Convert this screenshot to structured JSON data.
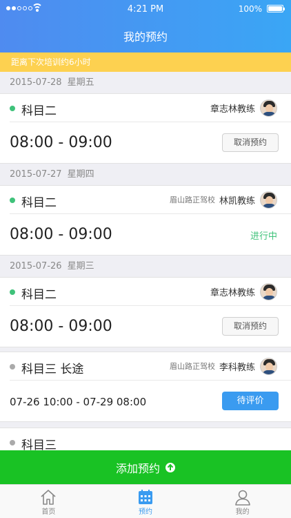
{
  "status_bar": {
    "time": "4:21 PM",
    "battery": "100%"
  },
  "header": {
    "title": "我的预约"
  },
  "banner": {
    "text": "距离下次培训约6小时"
  },
  "appointments": [
    {
      "date": "2015-07-28",
      "weekday": "星期五",
      "subject": "科目二",
      "school": "",
      "coach": "章志林教练",
      "range": "08:00 - 09:00",
      "action": "取消预约",
      "status_color": "#3fc27a"
    },
    {
      "date": "2015-07-27",
      "weekday": "星期四",
      "subject": "科目二",
      "school": "眉山路正驾校",
      "coach": "林凯教练",
      "range": "08:00 - 09:00",
      "action": "进行中",
      "status_color": "#3fc27a"
    },
    {
      "date": "2015-07-26",
      "weekday": "星期三",
      "subject": "科目二",
      "school": "",
      "coach": "章志林教练",
      "range": "08:00 - 09:00",
      "action": "取消预约",
      "status_color": "#3fc27a"
    },
    {
      "date": "",
      "weekday": "",
      "subject": "科目三 长途",
      "school": "眉山路正驾校",
      "coach": "李科教练",
      "range": "07-26 10:00 - 07-29 08:00",
      "action": "待评价",
      "status_color": "#aaaaaa"
    }
  ],
  "partial_card": {
    "subject": "科目三"
  },
  "add_button": {
    "label": "添加预约"
  },
  "tabbar": {
    "items": [
      {
        "label": "首页",
        "icon": "home-icon"
      },
      {
        "label": "预约",
        "icon": "calendar-icon"
      },
      {
        "label": "我的",
        "icon": "user-icon"
      }
    ],
    "active": 1
  },
  "colors": {
    "header": "#4f8bf0",
    "banner": "#fdd150",
    "add_button": "#19c224",
    "accent": "#3a9bf0"
  }
}
